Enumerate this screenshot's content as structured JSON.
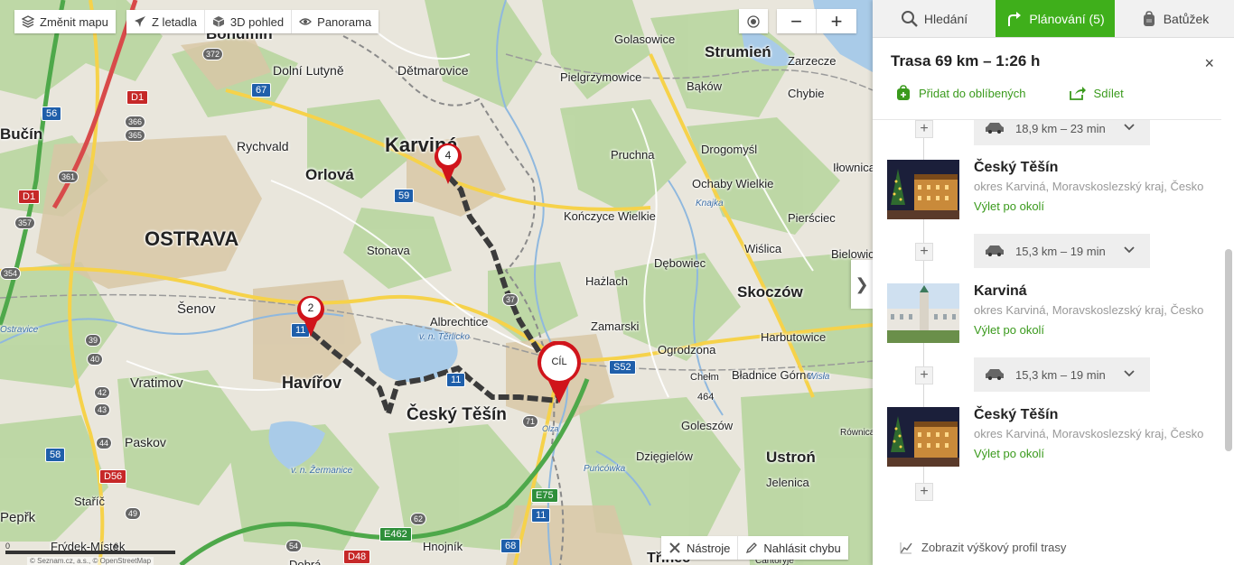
{
  "map": {
    "buttons": {
      "change_map": "Změnit mapu",
      "from_plane": "Z letadla",
      "view_3d": "3D pohled",
      "panorama": "Panorama"
    },
    "zoom": {
      "minus": "−",
      "plus": "+"
    },
    "tools": {
      "tools_label": "Nástroje",
      "report_label": "Nahlásit chybu"
    },
    "collapse_glyph": "❯",
    "scale": {
      "left": "0",
      "mid": "6"
    },
    "attribution": "© Seznam.cz, a.s., © OpenStreetMap",
    "place_labels": [
      {
        "text": "Bohumín",
        "big": false
      },
      {
        "text": "Dolní Lutyně",
        "big": false
      },
      {
        "text": "Dětmarovice",
        "big": false
      },
      {
        "text": "Rychvald",
        "big": false
      },
      {
        "text": "Orlová",
        "big": false
      },
      {
        "text": "Karviná",
        "big": false
      },
      {
        "text": "OSTRAVA",
        "big": true
      },
      {
        "text": "Stonava",
        "big": false
      },
      {
        "text": "Šenov",
        "big": false
      },
      {
        "text": "Albrechtice",
        "big": false
      },
      {
        "text": "Havířov",
        "big": false
      },
      {
        "text": "Vratimov",
        "big": false
      },
      {
        "text": "Český Těšín",
        "big": false
      },
      {
        "text": "Paskov",
        "big": false
      },
      {
        "text": "Staříč",
        "big": false
      },
      {
        "text": "Frýdek-Místek",
        "big": false
      },
      {
        "text": "Hnojník",
        "big": false
      },
      {
        "text": "Dobrá",
        "big": false
      },
      {
        "text": "Golasowice",
        "big": false
      },
      {
        "text": "Strumień",
        "big": false
      },
      {
        "text": "Zarzecze",
        "big": false
      },
      {
        "text": "Pielgrzymowice",
        "big": false
      },
      {
        "text": "Bąków",
        "big": false
      },
      {
        "text": "Chybie",
        "big": false
      },
      {
        "text": "Pruchna",
        "big": false
      },
      {
        "text": "Drogomyśl",
        "big": false
      },
      {
        "text": "Ochaby Wielkie",
        "big": false
      },
      {
        "text": "Kończyce Wielkie",
        "big": false
      },
      {
        "text": "Pierściec",
        "big": false
      },
      {
        "text": "Iłownica",
        "big": false
      },
      {
        "text": "Wiślica",
        "big": false
      },
      {
        "text": "Bielowicko",
        "big": false
      },
      {
        "text": "Dębowiec",
        "big": false
      },
      {
        "text": "Hażlach",
        "big": false
      },
      {
        "text": "Skoczów",
        "big": false
      },
      {
        "text": "Zamarski",
        "big": false
      },
      {
        "text": "Ogrodzona",
        "big": false
      },
      {
        "text": "Harbutowice",
        "big": false
      },
      {
        "text": "Bładnice Górne",
        "big": false
      },
      {
        "text": "Goleszów",
        "big": false
      },
      {
        "text": "Dzięgielów",
        "big": false
      },
      {
        "text": "Ustroń",
        "big": false
      },
      {
        "text": "Jelenica",
        "big": false
      },
      {
        "text": "Třinec",
        "big": false
      },
      {
        "text": "Chełm",
        "big": false
      },
      {
        "text": "464",
        "big": false
      },
      {
        "text": "Równica",
        "big": false
      },
      {
        "text": "Cantoryje",
        "big": false
      },
      {
        "text": "Bučín",
        "big": false
      },
      {
        "text": "Pepřk",
        "big": false
      },
      {
        "text": "v. n. Těrlicko",
        "big": false
      },
      {
        "text": "v. n. Žermanice",
        "big": false
      },
      {
        "text": "Olza",
        "big": false
      },
      {
        "text": "Puńcówka",
        "big": false
      },
      {
        "text": "Knajka",
        "big": false
      },
      {
        "text": "Wisła",
        "big": false
      },
      {
        "text": "Ostravice",
        "big": false
      }
    ],
    "road_shields": [
      {
        "text": "D1",
        "kind": "red"
      },
      {
        "text": "D1",
        "kind": "red"
      },
      {
        "text": "D56",
        "kind": "red"
      },
      {
        "text": "D48",
        "kind": "red"
      },
      {
        "text": "67",
        "kind": "blue"
      },
      {
        "text": "56",
        "kind": "blue"
      },
      {
        "text": "59",
        "kind": "blue"
      },
      {
        "text": "58",
        "kind": "blue"
      },
      {
        "text": "11",
        "kind": "blue"
      },
      {
        "text": "11",
        "kind": "blue"
      },
      {
        "text": "11",
        "kind": "blue"
      },
      {
        "text": "68",
        "kind": "blue"
      },
      {
        "text": "E75",
        "kind": "green"
      },
      {
        "text": "E462",
        "kind": "green"
      },
      {
        "text": "S52",
        "kind": "blue"
      },
      {
        "text": "372",
        "kind": "gray"
      },
      {
        "text": "366",
        "kind": "gray"
      },
      {
        "text": "365",
        "kind": "gray"
      },
      {
        "text": "361",
        "kind": "gray"
      },
      {
        "text": "357",
        "kind": "gray"
      },
      {
        "text": "354",
        "kind": "gray"
      },
      {
        "text": "39",
        "kind": "gray"
      },
      {
        "text": "40",
        "kind": "gray"
      },
      {
        "text": "42",
        "kind": "gray"
      },
      {
        "text": "43",
        "kind": "gray"
      },
      {
        "text": "44",
        "kind": "gray"
      },
      {
        "text": "49",
        "kind": "gray"
      },
      {
        "text": "71",
        "kind": "gray"
      },
      {
        "text": "62",
        "kind": "gray"
      },
      {
        "text": "54",
        "kind": "gray"
      },
      {
        "text": "37",
        "kind": "gray"
      }
    ],
    "pins": [
      {
        "label": "4",
        "kind": "small"
      },
      {
        "label": "2",
        "kind": "small"
      },
      {
        "label": "CÍL",
        "kind": "large"
      }
    ]
  },
  "panel": {
    "tabs": [
      {
        "label": "Hledání",
        "icon": "search-icon",
        "active": false
      },
      {
        "label": "Plánování (5)",
        "icon": "route-arrow-icon",
        "active": true
      },
      {
        "label": "Batůžek",
        "icon": "backpack-icon",
        "active": false
      }
    ],
    "route_title": "Trasa 69 km – 1:26 h",
    "close_glyph": "×",
    "add_favorite": "Přidat do oblíbených",
    "share": "Sdílet",
    "plus_glyph": "+",
    "segments": [
      {
        "text": "18,9 km – 23 min"
      },
      {
        "text": "15,3 km – 19 min"
      },
      {
        "text": "15,3 km – 19 min"
      }
    ],
    "stops": [
      {
        "name": "Český Těšín",
        "sub": "okres Karviná, Moravskoslezský kraj, Česko",
        "link": "Výlet po okolí"
      },
      {
        "name": "Karviná",
        "sub": "okres Karviná, Moravskoslezský kraj, Česko",
        "link": "Výlet po okolí"
      },
      {
        "name": "Český Těšín",
        "sub": "okres Karviná, Moravskoslezský kraj, Česko",
        "link": "Výlet po okolí"
      }
    ],
    "profile_label": "Zobrazit výškový profil trasy"
  },
  "colors": {
    "accent_green": "#3faf1b",
    "link_green": "#3a9a1c",
    "route_dark": "#3b3b3b",
    "pin_red": "#d0141b"
  }
}
